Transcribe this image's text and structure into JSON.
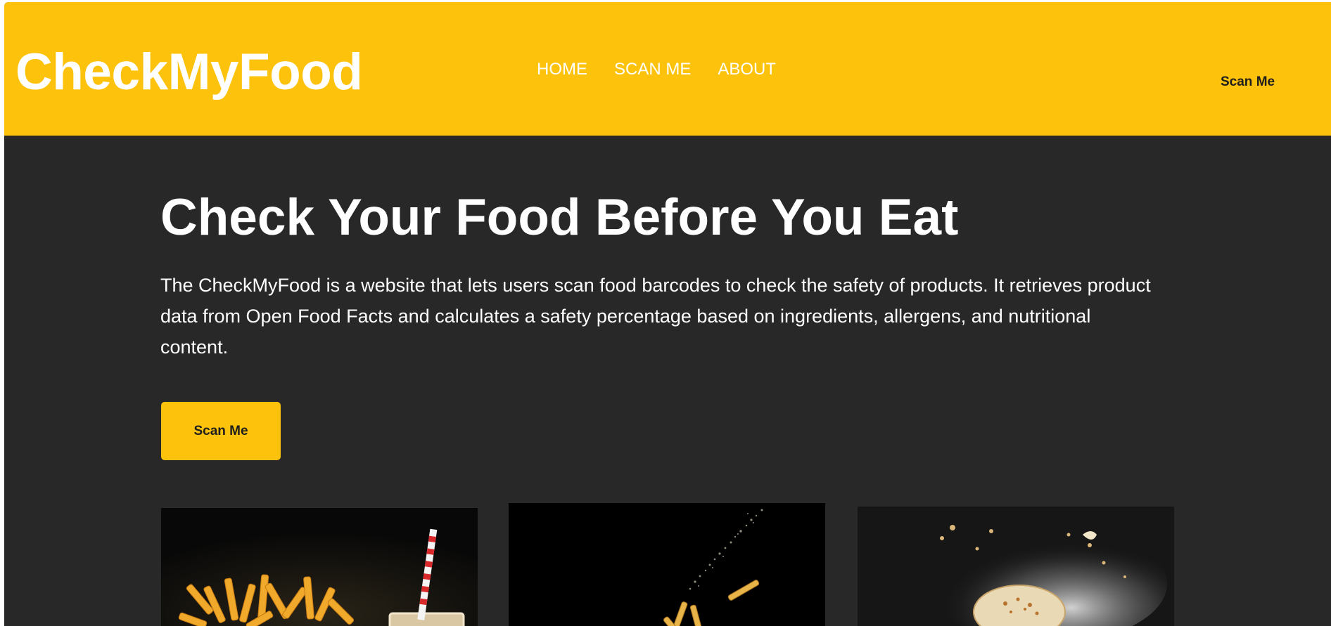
{
  "header": {
    "logo": "CheckMyFood",
    "nav": [
      {
        "label": "HOME"
      },
      {
        "label": "SCAN ME"
      },
      {
        "label": "ABOUT"
      }
    ],
    "cta_label": "Scan Me"
  },
  "hero": {
    "title": "Check Your Food Before You Eat",
    "description": "The CheckMyFood is a website that lets users scan food barcodes to check the safety of products. It retrieves product data from Open Food Facts and calculates a safety percentage based on ingredients, allergens, and nutritional content.",
    "button_label": "Scan Me"
  },
  "colors": {
    "accent": "#fdc20b",
    "background": "#282828",
    "text": "#ffffff"
  }
}
